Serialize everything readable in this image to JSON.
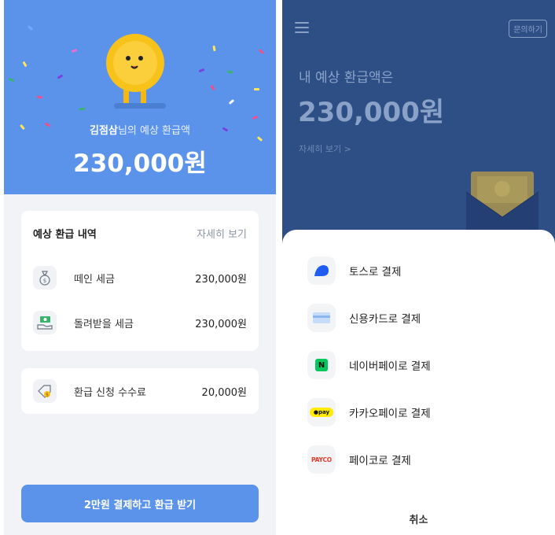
{
  "left": {
    "hero": {
      "name": "김점삼",
      "subtitle_suffix": "님의 예상 환급액",
      "amount": "230,000원"
    },
    "breakdown": {
      "title": "예상 환급 내역",
      "detail_link": "자세히 보기",
      "rows": [
        {
          "icon": "money-bag-icon",
          "label": "떼인 세금",
          "value": "230,000원"
        },
        {
          "icon": "cash-return-icon",
          "label": "돌려받을 세금",
          "value": "230,000원"
        }
      ]
    },
    "fee": {
      "icon": "fee-tag-icon",
      "label": "환급 신청 수수료",
      "value": "20,000원"
    },
    "cta": "2만원 결제하고 환급 받기",
    "colors": {
      "primary": "#5b93eb",
      "background": "#f2f3f6"
    }
  },
  "right": {
    "header": {
      "inquiry_button": "문의하기"
    },
    "title": "내 예상 환급액은",
    "amount": "230,000원",
    "detail_link": "자세히 보기 >",
    "payment_sheet": {
      "options": [
        {
          "icon": "toss-icon",
          "label": "토스로 결제"
        },
        {
          "icon": "credit-card-icon",
          "label": "신용카드로 결제"
        },
        {
          "icon": "naver-pay-icon",
          "icon_text": "N",
          "label": "네이버페이로 결제"
        },
        {
          "icon": "kakao-pay-icon",
          "icon_text": "●pay",
          "label": "카카오페이로 결제"
        },
        {
          "icon": "payco-icon",
          "icon_text": "PAYCO",
          "label": "페이코로 결제"
        }
      ],
      "cancel": "취소"
    },
    "colors": {
      "overlay_header": "#2d4f86",
      "muted_text": "#8aa2c7"
    }
  }
}
